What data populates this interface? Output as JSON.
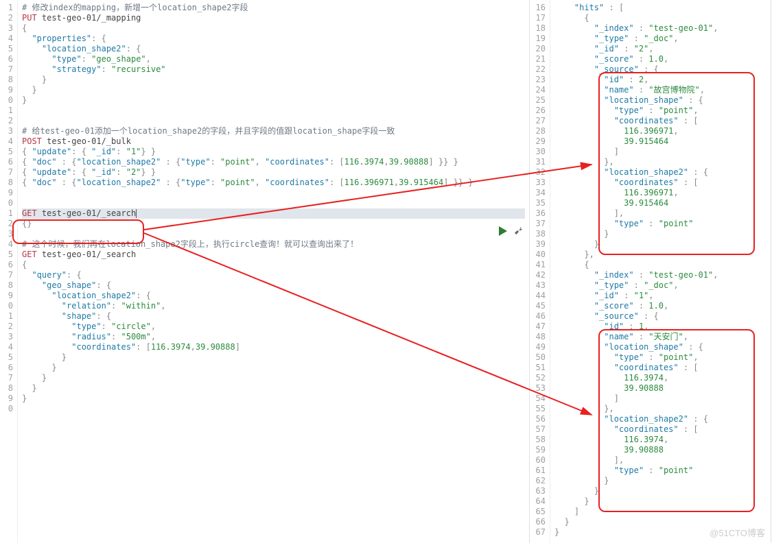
{
  "watermark": "@51CTO博客",
  "left": {
    "start": 1,
    "lines": [
      {
        "t": "comment",
        "raw": "# 修改index的mapping，新增一个location_shape2字段"
      },
      {
        "t": "req",
        "verb": "PUT",
        "url": "test-geo-01/_mapping"
      },
      {
        "t": "json",
        "raw": "{"
      },
      {
        "t": "json",
        "indent": 1,
        "segs": [
          [
            "key",
            "\"properties\""
          ],
          [
            "punc",
            ": {"
          ]
        ]
      },
      {
        "t": "json",
        "indent": 2,
        "segs": [
          [
            "key",
            "\"location_shape2\""
          ],
          [
            "punc",
            ": {"
          ]
        ]
      },
      {
        "t": "json",
        "indent": 3,
        "segs": [
          [
            "key",
            "\"type\""
          ],
          [
            "punc",
            ": "
          ],
          [
            "str",
            "\"geo_shape\""
          ],
          [
            "punc",
            ","
          ]
        ]
      },
      {
        "t": "json",
        "indent": 3,
        "segs": [
          [
            "key",
            "\"strategy\""
          ],
          [
            "punc",
            ": "
          ],
          [
            "str",
            "\"recursive\""
          ]
        ]
      },
      {
        "t": "json",
        "indent": 2,
        "raw": "}"
      },
      {
        "t": "json",
        "indent": 1,
        "raw": "}"
      },
      {
        "t": "json",
        "raw": "}"
      },
      {
        "t": "blank"
      },
      {
        "t": "blank"
      },
      {
        "t": "comment",
        "raw": "# 给test-geo-01添加一个location_shape2的字段，并且字段的值跟location_shape字段一致"
      },
      {
        "t": "req",
        "verb": "POST",
        "url": "test-geo-01/_bulk"
      },
      {
        "t": "json",
        "segs": [
          [
            "punc",
            "{ "
          ],
          [
            "key",
            "\"update\""
          ],
          [
            "punc",
            ": { "
          ],
          [
            "key",
            "\"_id\""
          ],
          [
            "punc",
            ": "
          ],
          [
            "str",
            "\"1\""
          ],
          [
            "punc",
            "} }"
          ]
        ]
      },
      {
        "t": "json",
        "segs": [
          [
            "punc",
            "{ "
          ],
          [
            "key",
            "\"doc\""
          ],
          [
            "punc",
            " : {"
          ],
          [
            "key",
            "\"location_shape2\""
          ],
          [
            "punc",
            " : {"
          ],
          [
            "key",
            "\"type\""
          ],
          [
            "punc",
            ": "
          ],
          [
            "str",
            "\"point\""
          ],
          [
            "punc",
            ", "
          ],
          [
            "key",
            "\"coordinates\""
          ],
          [
            "punc",
            ": ["
          ],
          [
            "num",
            "116.3974"
          ],
          [
            "punc",
            ","
          ],
          [
            "num",
            "39.90888"
          ],
          [
            "punc",
            "] }} }"
          ]
        ]
      },
      {
        "t": "json",
        "segs": [
          [
            "punc",
            "{ "
          ],
          [
            "key",
            "\"update\""
          ],
          [
            "punc",
            ": { "
          ],
          [
            "key",
            "\"_id\""
          ],
          [
            "punc",
            ": "
          ],
          [
            "str",
            "\"2\""
          ],
          [
            "punc",
            "} }"
          ]
        ]
      },
      {
        "t": "json",
        "segs": [
          [
            "punc",
            "{ "
          ],
          [
            "key",
            "\"doc\""
          ],
          [
            "punc",
            " : {"
          ],
          [
            "key",
            "\"location_shape2\""
          ],
          [
            "punc",
            " : {"
          ],
          [
            "key",
            "\"type\""
          ],
          [
            "punc",
            ": "
          ],
          [
            "str",
            "\"point\""
          ],
          [
            "punc",
            ", "
          ],
          [
            "key",
            "\"coordinates\""
          ],
          [
            "punc",
            ": ["
          ],
          [
            "num",
            "116.396971"
          ],
          [
            "punc",
            ","
          ],
          [
            "num",
            "39.915464"
          ],
          [
            "punc",
            "] }} }"
          ]
        ]
      },
      {
        "t": "blank"
      },
      {
        "t": "blank"
      },
      {
        "t": "req",
        "verb": "GET",
        "url": "test-geo-01/_search",
        "cursor": true
      },
      {
        "t": "json",
        "raw": "{}"
      },
      {
        "t": "blank"
      },
      {
        "t": "comment",
        "raw": "# 这个时候，我们再在location_shape2字段上，执行circle查询！就可以查询出来了！"
      },
      {
        "t": "req",
        "verb": "GET",
        "url": "test-geo-01/_search"
      },
      {
        "t": "json",
        "raw": "{"
      },
      {
        "t": "json",
        "indent": 1,
        "segs": [
          [
            "key",
            "\"query\""
          ],
          [
            "punc",
            ": {"
          ]
        ]
      },
      {
        "t": "json",
        "indent": 2,
        "segs": [
          [
            "key",
            "\"geo_shape\""
          ],
          [
            "punc",
            ": {"
          ]
        ]
      },
      {
        "t": "json",
        "indent": 3,
        "segs": [
          [
            "key",
            "\"location_shape2\""
          ],
          [
            "punc",
            ": {"
          ]
        ]
      },
      {
        "t": "json",
        "indent": 4,
        "segs": [
          [
            "key",
            "\"relation\""
          ],
          [
            "punc",
            ": "
          ],
          [
            "str",
            "\"within\""
          ],
          [
            "punc",
            ","
          ]
        ]
      },
      {
        "t": "json",
        "indent": 4,
        "segs": [
          [
            "key",
            "\"shape\""
          ],
          [
            "punc",
            ": {"
          ]
        ]
      },
      {
        "t": "json",
        "indent": 5,
        "segs": [
          [
            "key",
            "\"type\""
          ],
          [
            "punc",
            ": "
          ],
          [
            "str",
            "\"circle\""
          ],
          [
            "punc",
            ","
          ]
        ]
      },
      {
        "t": "json",
        "indent": 5,
        "segs": [
          [
            "key",
            "\"radius\""
          ],
          [
            "punc",
            ": "
          ],
          [
            "str",
            "\"500m\""
          ],
          [
            "punc",
            ","
          ]
        ]
      },
      {
        "t": "json",
        "indent": 5,
        "segs": [
          [
            "key",
            "\"coordinates\""
          ],
          [
            "punc",
            ": ["
          ],
          [
            "num",
            "116.3974"
          ],
          [
            "punc",
            ","
          ],
          [
            "num",
            "39.90888"
          ],
          [
            "punc",
            "]"
          ]
        ]
      },
      {
        "t": "json",
        "indent": 4,
        "raw": "}"
      },
      {
        "t": "json",
        "indent": 3,
        "raw": "}"
      },
      {
        "t": "json",
        "indent": 2,
        "raw": "}"
      },
      {
        "t": "json",
        "indent": 1,
        "raw": "}"
      },
      {
        "t": "json",
        "raw": "}"
      },
      {
        "t": "blank"
      }
    ]
  },
  "right": {
    "start": 16,
    "lines": [
      {
        "t": "json",
        "indent": 2,
        "segs": [
          [
            "key",
            "\"hits\""
          ],
          [
            "punc",
            " : ["
          ]
        ]
      },
      {
        "t": "json",
        "indent": 3,
        "raw": "{"
      },
      {
        "t": "json",
        "indent": 4,
        "segs": [
          [
            "key",
            "\"_index\""
          ],
          [
            "punc",
            " : "
          ],
          [
            "str",
            "\"test-geo-01\""
          ],
          [
            "punc",
            ","
          ]
        ]
      },
      {
        "t": "json",
        "indent": 4,
        "segs": [
          [
            "key",
            "\"_type\""
          ],
          [
            "punc",
            " : "
          ],
          [
            "str",
            "\"_doc\""
          ],
          [
            "punc",
            ","
          ]
        ]
      },
      {
        "t": "json",
        "indent": 4,
        "segs": [
          [
            "key",
            "\"_id\""
          ],
          [
            "punc",
            " : "
          ],
          [
            "str",
            "\"2\""
          ],
          [
            "punc",
            ","
          ]
        ]
      },
      {
        "t": "json",
        "indent": 4,
        "segs": [
          [
            "key",
            "\"_score\""
          ],
          [
            "punc",
            " : "
          ],
          [
            "num",
            "1.0"
          ],
          [
            "punc",
            ","
          ]
        ]
      },
      {
        "t": "json",
        "indent": 4,
        "segs": [
          [
            "key",
            "\"_source\""
          ],
          [
            "punc",
            " : {"
          ]
        ]
      },
      {
        "t": "json",
        "indent": 5,
        "segs": [
          [
            "key",
            "\"id\""
          ],
          [
            "punc",
            " : "
          ],
          [
            "num",
            "2"
          ],
          [
            "punc",
            ","
          ]
        ]
      },
      {
        "t": "json",
        "indent": 5,
        "segs": [
          [
            "key",
            "\"name\""
          ],
          [
            "punc",
            " : "
          ],
          [
            "str",
            "\"故宫博物院\""
          ],
          [
            "punc",
            ","
          ]
        ]
      },
      {
        "t": "json",
        "indent": 5,
        "segs": [
          [
            "key",
            "\"location_shape\""
          ],
          [
            "punc",
            " : {"
          ]
        ]
      },
      {
        "t": "json",
        "indent": 6,
        "segs": [
          [
            "key",
            "\"type\""
          ],
          [
            "punc",
            " : "
          ],
          [
            "str",
            "\"point\""
          ],
          [
            "punc",
            ","
          ]
        ]
      },
      {
        "t": "json",
        "indent": 6,
        "segs": [
          [
            "key",
            "\"coordinates\""
          ],
          [
            "punc",
            " : ["
          ]
        ]
      },
      {
        "t": "json",
        "indent": 7,
        "segs": [
          [
            "num",
            "116.396971"
          ],
          [
            "punc",
            ","
          ]
        ]
      },
      {
        "t": "json",
        "indent": 7,
        "segs": [
          [
            "num",
            "39.915464"
          ]
        ]
      },
      {
        "t": "json",
        "indent": 6,
        "raw": "]"
      },
      {
        "t": "json",
        "indent": 5,
        "raw": "},"
      },
      {
        "t": "json",
        "indent": 5,
        "segs": [
          [
            "key",
            "\"location_shape2\""
          ],
          [
            "punc",
            " : {"
          ]
        ]
      },
      {
        "t": "json",
        "indent": 6,
        "segs": [
          [
            "key",
            "\"coordinates\""
          ],
          [
            "punc",
            " : ["
          ]
        ]
      },
      {
        "t": "json",
        "indent": 7,
        "segs": [
          [
            "num",
            "116.396971"
          ],
          [
            "punc",
            ","
          ]
        ]
      },
      {
        "t": "json",
        "indent": 7,
        "segs": [
          [
            "num",
            "39.915464"
          ]
        ]
      },
      {
        "t": "json",
        "indent": 6,
        "raw": "],"
      },
      {
        "t": "json",
        "indent": 6,
        "segs": [
          [
            "key",
            "\"type\""
          ],
          [
            "punc",
            " : "
          ],
          [
            "str",
            "\"point\""
          ]
        ]
      },
      {
        "t": "json",
        "indent": 5,
        "raw": "}"
      },
      {
        "t": "json",
        "indent": 4,
        "raw": "}"
      },
      {
        "t": "json",
        "indent": 3,
        "raw": "},"
      },
      {
        "t": "json",
        "indent": 3,
        "raw": "{"
      },
      {
        "t": "json",
        "indent": 4,
        "segs": [
          [
            "key",
            "\"_index\""
          ],
          [
            "punc",
            " : "
          ],
          [
            "str",
            "\"test-geo-01\""
          ],
          [
            "punc",
            ","
          ]
        ]
      },
      {
        "t": "json",
        "indent": 4,
        "segs": [
          [
            "key",
            "\"_type\""
          ],
          [
            "punc",
            " : "
          ],
          [
            "str",
            "\"_doc\""
          ],
          [
            "punc",
            ","
          ]
        ]
      },
      {
        "t": "json",
        "indent": 4,
        "segs": [
          [
            "key",
            "\"_id\""
          ],
          [
            "punc",
            " : "
          ],
          [
            "str",
            "\"1\""
          ],
          [
            "punc",
            ","
          ]
        ]
      },
      {
        "t": "json",
        "indent": 4,
        "segs": [
          [
            "key",
            "\"_score\""
          ],
          [
            "punc",
            " : "
          ],
          [
            "num",
            "1.0"
          ],
          [
            "punc",
            ","
          ]
        ]
      },
      {
        "t": "json",
        "indent": 4,
        "segs": [
          [
            "key",
            "\"_source\""
          ],
          [
            "punc",
            " : {"
          ]
        ]
      },
      {
        "t": "json",
        "indent": 5,
        "segs": [
          [
            "key",
            "\"id\""
          ],
          [
            "punc",
            " : "
          ],
          [
            "num",
            "1"
          ],
          [
            "punc",
            ","
          ]
        ]
      },
      {
        "t": "json",
        "indent": 5,
        "segs": [
          [
            "key",
            "\"name\""
          ],
          [
            "punc",
            " : "
          ],
          [
            "str",
            "\"天安门\""
          ],
          [
            "punc",
            ","
          ]
        ]
      },
      {
        "t": "json",
        "indent": 5,
        "segs": [
          [
            "key",
            "\"location_shape\""
          ],
          [
            "punc",
            " : {"
          ]
        ]
      },
      {
        "t": "json",
        "indent": 6,
        "segs": [
          [
            "key",
            "\"type\""
          ],
          [
            "punc",
            " : "
          ],
          [
            "str",
            "\"point\""
          ],
          [
            "punc",
            ","
          ]
        ]
      },
      {
        "t": "json",
        "indent": 6,
        "segs": [
          [
            "key",
            "\"coordinates\""
          ],
          [
            "punc",
            " : ["
          ]
        ]
      },
      {
        "t": "json",
        "indent": 7,
        "segs": [
          [
            "num",
            "116.3974"
          ],
          [
            "punc",
            ","
          ]
        ]
      },
      {
        "t": "json",
        "indent": 7,
        "segs": [
          [
            "num",
            "39.90888"
          ]
        ]
      },
      {
        "t": "json",
        "indent": 6,
        "raw": "]"
      },
      {
        "t": "json",
        "indent": 5,
        "raw": "},"
      },
      {
        "t": "json",
        "indent": 5,
        "segs": [
          [
            "key",
            "\"location_shape2\""
          ],
          [
            "punc",
            " : {"
          ]
        ]
      },
      {
        "t": "json",
        "indent": 6,
        "segs": [
          [
            "key",
            "\"coordinates\""
          ],
          [
            "punc",
            " : ["
          ]
        ]
      },
      {
        "t": "json",
        "indent": 7,
        "segs": [
          [
            "num",
            "116.3974"
          ],
          [
            "punc",
            ","
          ]
        ]
      },
      {
        "t": "json",
        "indent": 7,
        "segs": [
          [
            "num",
            "39.90888"
          ]
        ]
      },
      {
        "t": "json",
        "indent": 6,
        "raw": "],"
      },
      {
        "t": "json",
        "indent": 6,
        "segs": [
          [
            "key",
            "\"type\""
          ],
          [
            "punc",
            " : "
          ],
          [
            "str",
            "\"point\""
          ]
        ]
      },
      {
        "t": "json",
        "indent": 5,
        "raw": "}"
      },
      {
        "t": "json",
        "indent": 4,
        "raw": "}"
      },
      {
        "t": "json",
        "indent": 3,
        "raw": "}"
      },
      {
        "t": "json",
        "indent": 2,
        "raw": "]"
      },
      {
        "t": "json",
        "indent": 1,
        "raw": "}"
      },
      {
        "t": "json",
        "raw": "}"
      }
    ]
  }
}
